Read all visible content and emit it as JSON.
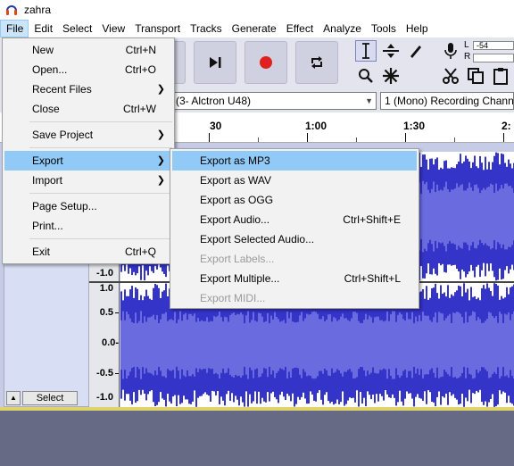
{
  "window": {
    "title": "zahra"
  },
  "menubar": [
    "File",
    "Edit",
    "Select",
    "View",
    "Transport",
    "Tracks",
    "Generate",
    "Effect",
    "Analyze",
    "Tools",
    "Help"
  ],
  "meter": {
    "lr": [
      "L",
      "R"
    ],
    "value": "-54"
  },
  "devices": {
    "input": "(3- Alctron U48)",
    "channels": "1 (Mono) Recording Channe"
  },
  "ruler": {
    "labels": [
      "30",
      "1:00",
      "1:30",
      "2:"
    ]
  },
  "track": {
    "scale_top": [
      "-1.0",
      "1.0",
      "0.5",
      "0.0-",
      "-0.5",
      "-1.0"
    ],
    "select_label": "Select",
    "collapse_glyph": "▲"
  },
  "file_menu": {
    "new": {
      "label": "New",
      "shortcut": "Ctrl+N"
    },
    "open": {
      "label": "Open...",
      "shortcut": "Ctrl+O"
    },
    "recent": {
      "label": "Recent Files"
    },
    "close": {
      "label": "Close",
      "shortcut": "Ctrl+W"
    },
    "save_project": {
      "label": "Save Project"
    },
    "export": {
      "label": "Export"
    },
    "import": {
      "label": "Import"
    },
    "page_setup": {
      "label": "Page Setup..."
    },
    "print": {
      "label": "Print..."
    },
    "exit": {
      "label": "Exit",
      "shortcut": "Ctrl+Q"
    }
  },
  "export_menu": {
    "mp3": {
      "label": "Export as MP3"
    },
    "wav": {
      "label": "Export as WAV"
    },
    "ogg": {
      "label": "Export as OGG"
    },
    "audio": {
      "label": "Export Audio...",
      "shortcut": "Ctrl+Shift+E"
    },
    "selected": {
      "label": "Export Selected Audio..."
    },
    "labels": {
      "label": "Export Labels..."
    },
    "multiple": {
      "label": "Export Multiple...",
      "shortcut": "Ctrl+Shift+L"
    },
    "midi": {
      "label": "Export MIDI..."
    }
  },
  "colors": {
    "waveform": "#3434c8",
    "waveform_rms": "#6b6be0",
    "highlight": "#91c9f7"
  }
}
